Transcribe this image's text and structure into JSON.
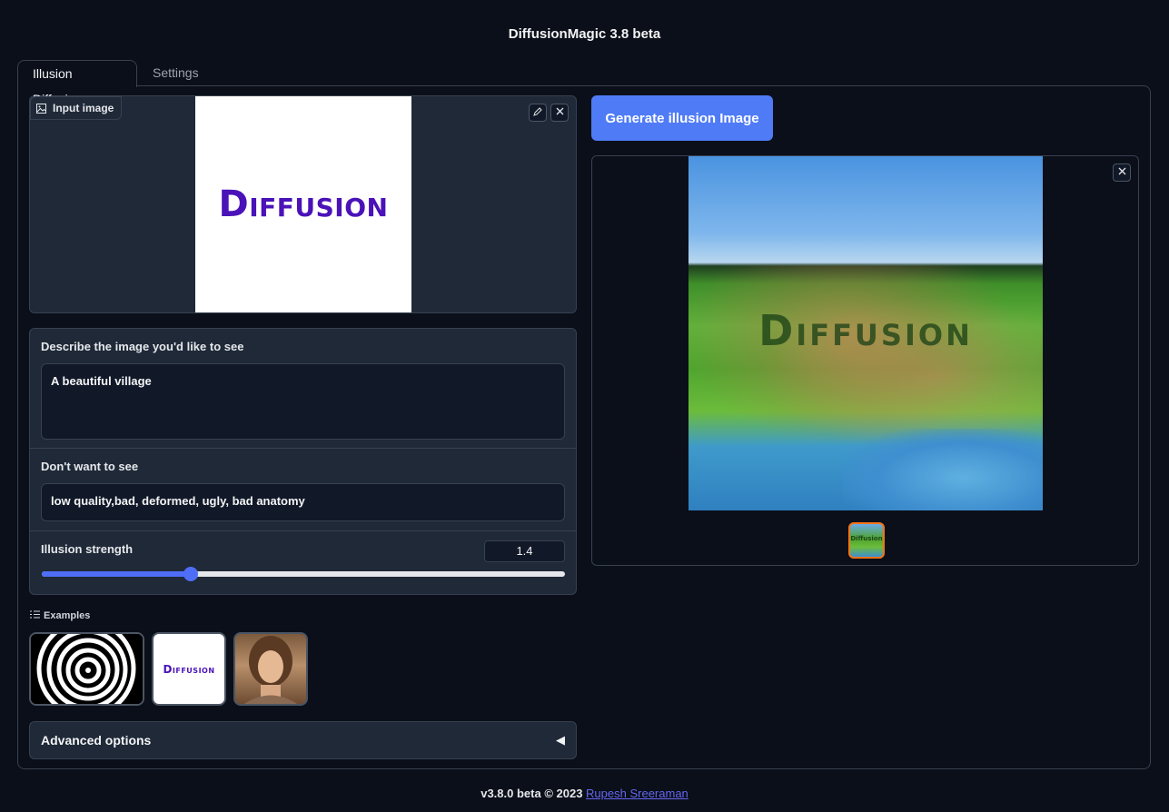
{
  "app": {
    "title": "DiffusionMagic 3.8 beta"
  },
  "tabs": [
    {
      "label": "Illusion Diffusion",
      "active": true
    },
    {
      "label": "Settings",
      "active": false
    }
  ],
  "input_image": {
    "label": "Input image",
    "image_text": "Diffusion",
    "edit_icon": "pencil-icon",
    "clear_icon": "close-icon"
  },
  "prompt": {
    "label": "Describe the image you'd like to see",
    "value": "A beautiful village"
  },
  "negative_prompt": {
    "label": "Don't want to see",
    "value": "low quality,bad, deformed, ugly, bad anatomy"
  },
  "illusion_strength": {
    "label": "Illusion strength",
    "value": "1.4",
    "fraction": 0.285
  },
  "examples": {
    "label": "Examples",
    "items": [
      {
        "name": "spiral"
      },
      {
        "name": "diffusion-logo",
        "text": "Diffusion"
      },
      {
        "name": "portrait"
      }
    ]
  },
  "advanced": {
    "label": "Advanced options",
    "arrow": "◀"
  },
  "generate_button": {
    "label": "Generate illusion Image"
  },
  "output": {
    "overlay_text": "Diffusion",
    "thumb_text": "Diffusion"
  },
  "footer": {
    "text": "v3.8.0 beta © 2023 ",
    "link_text": "Rupesh Sreeraman"
  },
  "colors": {
    "accent": "#4f7bf7",
    "selected_thumb": "#f97316",
    "logo_purple": "#4a12b8",
    "background": "#0b0f19"
  }
}
